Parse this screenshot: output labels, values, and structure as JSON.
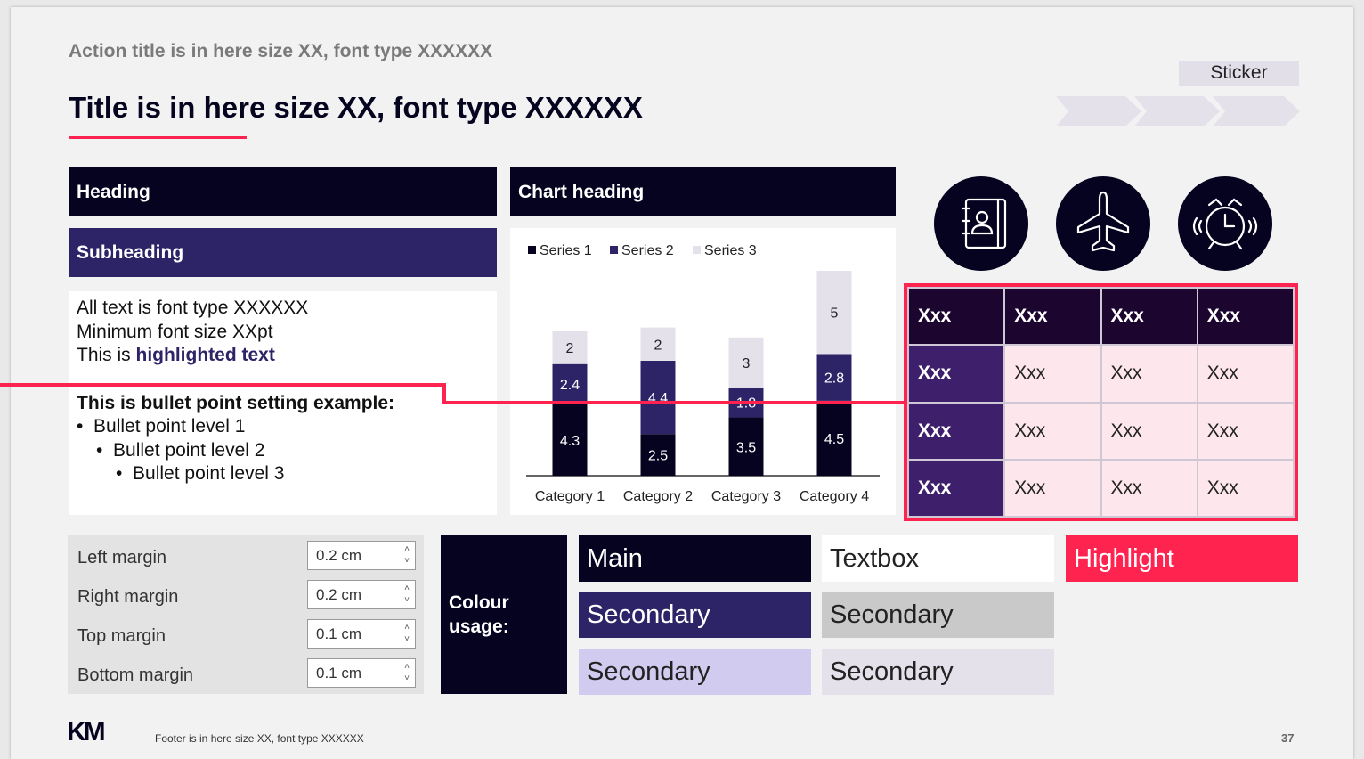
{
  "slide": {
    "action_title": "Action title is in here size XX, font type XXXXXX",
    "title": "Title is in here size XX, font type XXXXXX",
    "sticker": "Sticker",
    "footer": "Footer is in here size XX, font type XXXXXX",
    "page_number": "37",
    "logo_text": "KM"
  },
  "left_panel": {
    "heading": "Heading",
    "subheading": "Subheading",
    "lines": [
      "All text is font type XXXXXX",
      "Minimum font size XXpt"
    ],
    "highlight_prefix": "This is ",
    "highlight_text": "highlighted text",
    "bullet_title": "This is bullet point setting example:",
    "bullets": [
      "Bullet point level 1",
      "Bullet point level 2",
      "Bullet point level 3"
    ]
  },
  "chart_heading": "Chart heading",
  "chart_data": {
    "type": "bar",
    "stacked": true,
    "categories": [
      "Category 1",
      "Category 2",
      "Category 3",
      "Category 4"
    ],
    "series": [
      {
        "name": "Series 1",
        "values": [
          4.3,
          2.5,
          3.5,
          4.5
        ],
        "color": "#05031f"
      },
      {
        "name": "Series 2",
        "values": [
          2.4,
          4.4,
          1.8,
          2.8
        ],
        "color": "#2d2468"
      },
      {
        "name": "Series 3",
        "values": [
          2,
          2,
          3,
          5
        ],
        "color": "#e4e1ea"
      }
    ],
    "ylim": [
      0,
      12.3
    ],
    "legend": "top-left",
    "grid": false
  },
  "icons": [
    "contact-book-icon",
    "airplane-icon",
    "alarm-clock-icon"
  ],
  "table": {
    "header": [
      "Xxx",
      "Xxx",
      "Xxx",
      "Xxx"
    ],
    "rows": [
      [
        "Xxx",
        "Xxx",
        "Xxx",
        "Xxx"
      ],
      [
        "Xxx",
        "Xxx",
        "Xxx",
        "Xxx"
      ],
      [
        "Xxx",
        "Xxx",
        "Xxx",
        "Xxx"
      ]
    ]
  },
  "margins": [
    {
      "label": "Left margin",
      "value": "0.2 cm"
    },
    {
      "label": "Right margin",
      "value": "0.2 cm"
    },
    {
      "label": "Top margin",
      "value": "0.1 cm"
    },
    {
      "label": "Bottom margin",
      "value": "0.1 cm"
    }
  ],
  "colour_usage": {
    "label": "Colour usage:",
    "main": "Main",
    "textbox": "Textbox",
    "highlight": "Highlight",
    "secondary": "Secondary"
  },
  "colors": {
    "main": "#05031f",
    "secondary_purple": "#2d2468",
    "highlight": "#ff2450",
    "lavender": "#d0cbef",
    "grey": "#c9c9c9",
    "light_lavender": "#e4e1ea"
  }
}
